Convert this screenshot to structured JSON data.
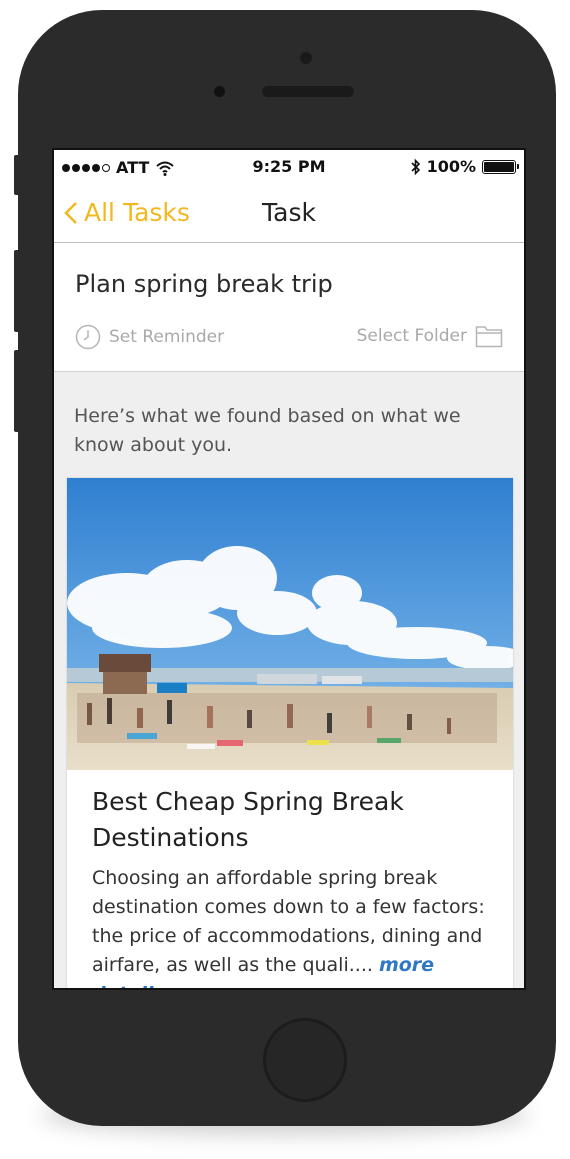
{
  "status_bar": {
    "carrier": "ATT",
    "time": "9:25 PM",
    "battery": "100%"
  },
  "nav": {
    "back_label": "All Tasks",
    "title": "Task"
  },
  "task": {
    "title": "Plan spring break trip",
    "reminder_label": "Set Reminder",
    "folder_label": "Select Folder"
  },
  "suggestions": {
    "intro": "Here’s what we found based on what we know about you.",
    "article": {
      "title": "Best Cheap Spring Break Destinations",
      "body": "Choosing an affordable spring break destination comes down to a few factors: the price of accommodations, dining and airfare, as well as the quali.... ",
      "more_label": "more details"
    }
  },
  "colors": {
    "accent": "#f3b81e",
    "link": "#2f78c4",
    "phone_body": "#2b2b2b"
  },
  "icons": [
    "signal-dots-icon",
    "wifi-icon",
    "bluetooth-icon",
    "battery-icon",
    "back-chevron-icon",
    "clock-icon",
    "folder-icon"
  ]
}
